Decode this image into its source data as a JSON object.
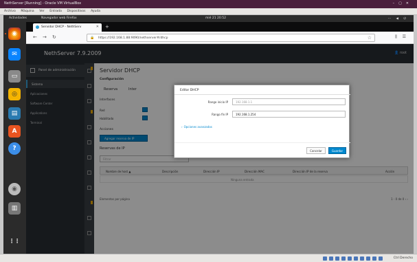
{
  "vbox": {
    "title": "NethServer [Running] - Oracle VM VirtualBox",
    "menu": [
      "Archivo",
      "Máquina",
      "Ver",
      "Entrada",
      "Dispositivos",
      "Ayuda"
    ],
    "host_key": "Ctrl Derecho"
  },
  "ubuntu": {
    "activities": "Actividades",
    "app": "Navegador web Firefox",
    "clock": "mié 21 20:52",
    "dock": [
      {
        "name": "firefox-icon",
        "color": "#e66000",
        "glyph": "◉"
      },
      {
        "name": "thunderbird-icon",
        "color": "#0a84ff",
        "glyph": "✉"
      },
      {
        "name": "files-icon",
        "color": "#888888",
        "glyph": "▭"
      },
      {
        "name": "rhythmbox-icon",
        "color": "#f5b400",
        "glyph": "◎"
      },
      {
        "name": "libreoffice-writer-icon",
        "color": "#2a7ab0",
        "glyph": "▤"
      },
      {
        "name": "software-icon",
        "color": "#e95420",
        "glyph": "A"
      },
      {
        "name": "help-icon",
        "color": "#3c8ee8",
        "glyph": "?"
      },
      {
        "name": "cd-icon",
        "color": "#bbbbbb",
        "glyph": "◉"
      },
      {
        "name": "trash-icon",
        "color": "#777777",
        "glyph": "▥"
      },
      {
        "name": "app-grid-icon",
        "color": "#2b2b2b",
        "glyph": "⋮⋮"
      }
    ]
  },
  "firefox": {
    "tab_title": "Servidor DHCP - NethServ",
    "url": "https://192.168.1.88:9090/nethserver#/dhcp",
    "back": "←",
    "forward": "→",
    "reload": "↻",
    "menu": "☰"
  },
  "nethserver": {
    "brand": "NethServer 7.9.2009",
    "user": "root",
    "left_header": "Panel de administración",
    "left_items": [
      {
        "label": "Sistema",
        "active": true
      },
      {
        "label": "Aplicaciones",
        "active": false
      },
      {
        "label": "Software Center",
        "active": false
      },
      {
        "label": "Applications",
        "active": false
      },
      {
        "label": "Terminal",
        "active": false
      }
    ],
    "page": {
      "title": "Servidor DHCP",
      "subtitle": "Configuración",
      "tab1": "Reserva",
      "tab2": "Inter",
      "section2": "Interfaces",
      "field1": "Red",
      "field2": "Habilitado",
      "section3": "Acciones",
      "add_button": "Agregar reserva de IP",
      "section4": "Reservas de IP",
      "filter_placeholder": "Filtrar",
      "columns": [
        "Nombre de host ▲",
        "Descripción",
        "Dirección IP",
        "Dirección MAC",
        "Dirección IP de la reserva",
        "Acción"
      ],
      "empty": "Ninguna entrada",
      "pager_left": "Elementos por página",
      "pager_right": "1 - 0 de 0 ‹ ›"
    },
    "modal": {
      "title": "Editar DHCP",
      "start_label": "Rango inicio IP",
      "start_value": "192.168.1.1",
      "end_label": "Rango fin IP",
      "end_value": "192.168.1.254",
      "advanced_link": "Opciones avanzadas",
      "cancel": "Cancelar",
      "save": "Guardar"
    }
  },
  "colors": {
    "accent": "#0088ce",
    "sidebar": "#292e34",
    "ubuntu_orange": "#e95420"
  }
}
